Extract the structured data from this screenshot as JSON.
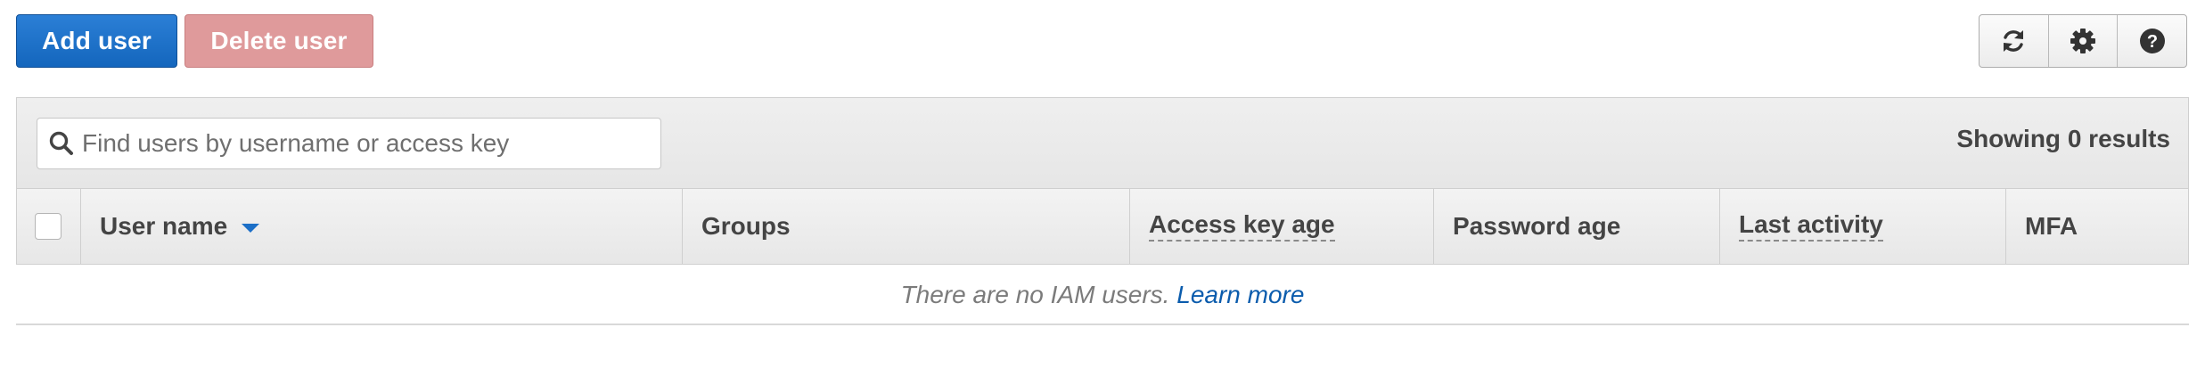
{
  "toolbar": {
    "add_label": "Add user",
    "delete_label": "Delete user",
    "icons": [
      "refresh-icon",
      "settings-gear-icon",
      "help-icon"
    ]
  },
  "filter": {
    "placeholder": "Find users by username or access key",
    "value": "",
    "results_text": "Showing 0 results"
  },
  "table": {
    "columns": [
      {
        "label": "User name",
        "sortable": true,
        "sort_direction": "descending"
      },
      {
        "label": "Groups"
      },
      {
        "label": "Access key age",
        "has_tooltip": true
      },
      {
        "label": "Password age"
      },
      {
        "label": "Last activity",
        "has_tooltip": true
      },
      {
        "label": "MFA"
      }
    ],
    "rows": []
  },
  "empty_state": {
    "message": "There are no IAM users.",
    "link_text": "Learn more"
  },
  "colors": {
    "primary": "#1c6fc7",
    "danger_disabled": "#df9a9b",
    "link": "#0b5cad"
  }
}
